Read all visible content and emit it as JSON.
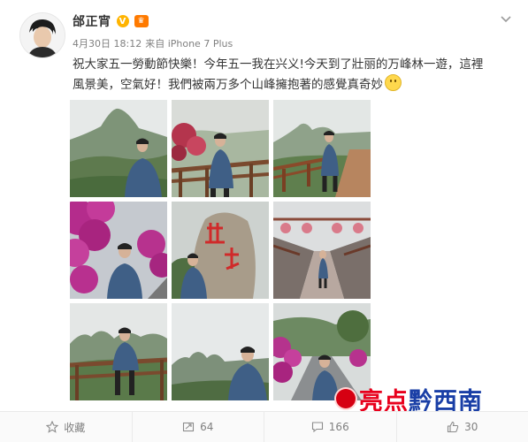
{
  "post": {
    "author": "邰正宵",
    "verified_label": "V",
    "date": "4月30日 18:12",
    "source": "来自 iPhone 7 Plus",
    "text": "祝大家五一勞動節快樂！今年五一我在兴义!今天到了壯丽的万峰林一遊，這裡風景美，空氣好！我們被兩万多个山峰擁抱著的感覺真奇妙"
  },
  "photos": [
    {
      "icon": "photo-mountain-man"
    },
    {
      "icon": "photo-railing-flowers"
    },
    {
      "icon": "photo-boardwalk"
    },
    {
      "icon": "photo-bougainvillea"
    },
    {
      "icon": "photo-carved-rock"
    },
    {
      "icon": "photo-garden-path"
    },
    {
      "icon": "photo-railing-peaks"
    },
    {
      "icon": "photo-peaks-selfie"
    },
    {
      "icon": "photo-flower-road"
    }
  ],
  "watermark": {
    "part1": "亮点",
    "part2": "黔西南"
  },
  "actions": {
    "favorite_label": "收藏",
    "repost_count": "64",
    "comment_count": "166",
    "like_count": "30"
  },
  "colors": {
    "verified": "#ffb400",
    "watermark_red": "#e8001c",
    "watermark_blue": "#1a3fa6"
  }
}
